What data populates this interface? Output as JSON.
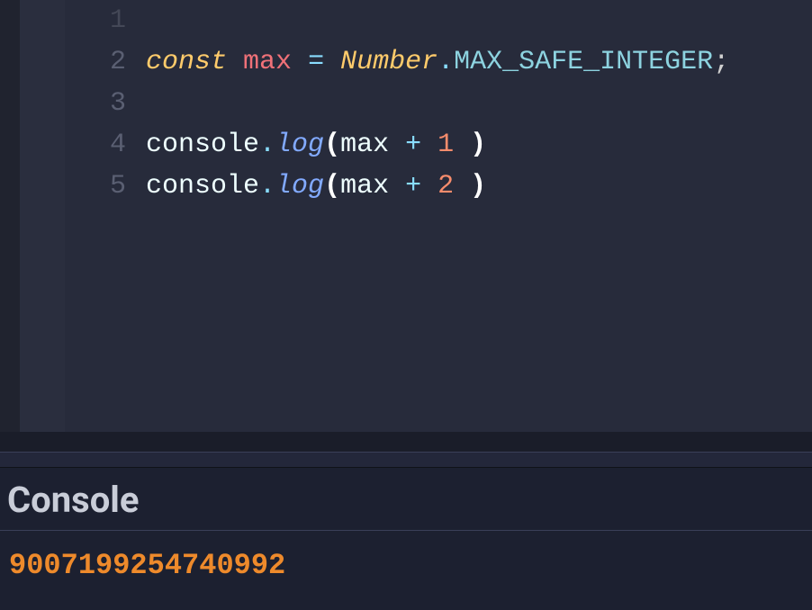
{
  "editor": {
    "gutter": {
      "lines": [
        "1",
        "2",
        "3",
        "4",
        "5"
      ]
    },
    "code": {
      "line1": "",
      "line2": {
        "kw_const": "const",
        "sp1": " ",
        "var_max": "max",
        "sp2": " ",
        "eq": "=",
        "sp3": " ",
        "number_obj": "Number",
        "dot": ".",
        "prop": "MAX_SAFE_INTEGER",
        "semi": ";"
      },
      "line3": "",
      "line4": {
        "obj": "console",
        "dot1": ".",
        "method": "log",
        "lparen": "(",
        "arg": "max",
        "sp1": " ",
        "plus": "+",
        "sp2": " ",
        "num": "1",
        "sp3": " ",
        "rparen": ")"
      },
      "line5": {
        "obj": "console",
        "dot1": ".",
        "method": "log",
        "lparen": "(",
        "arg": "max",
        "sp1": " ",
        "plus": "+",
        "sp2": " ",
        "num": "2",
        "sp3": " ",
        "rparen": ")"
      }
    }
  },
  "console": {
    "title": "Console",
    "output": "9007199254740992"
  }
}
